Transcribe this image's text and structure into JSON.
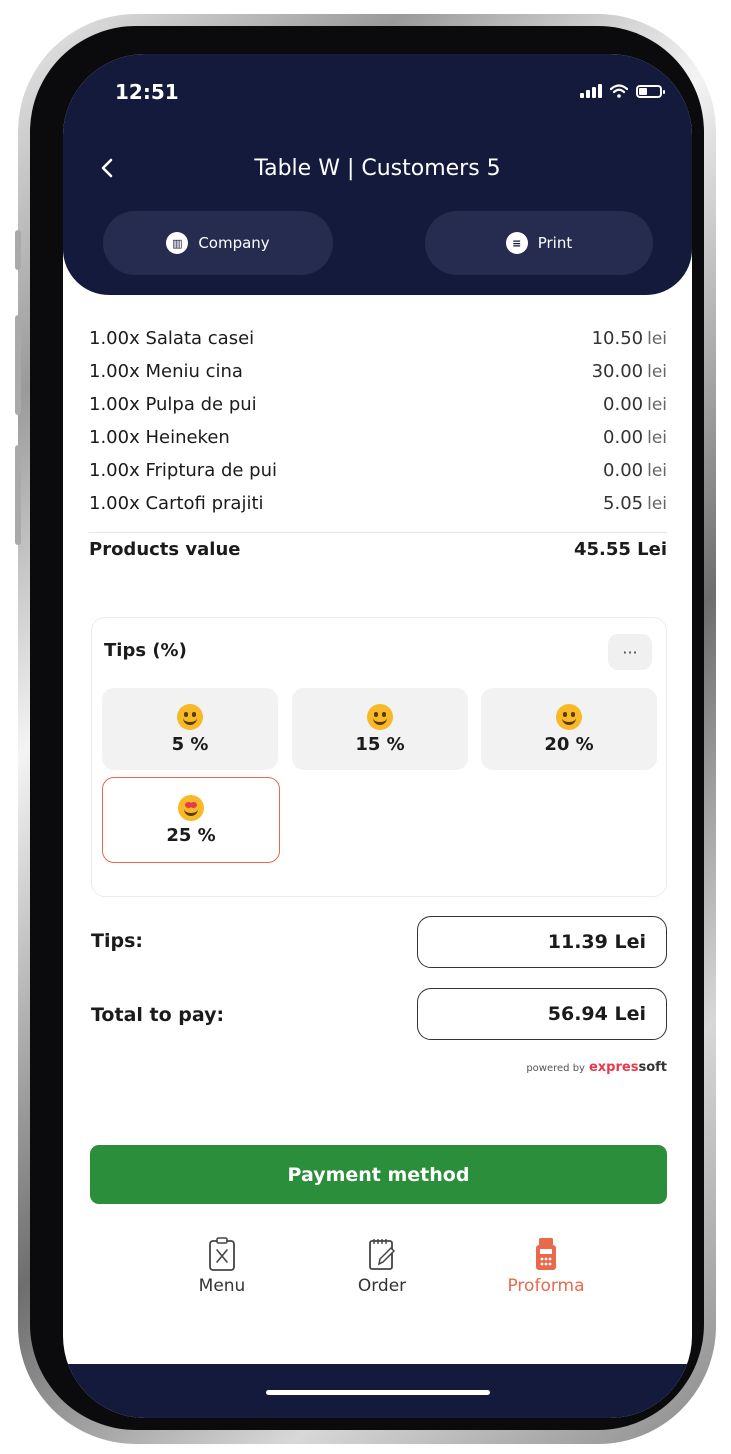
{
  "status_bar": {
    "time": "12:51"
  },
  "header": {
    "title": "Table W | Customers 5",
    "company_label": "Company",
    "print_label": "Print"
  },
  "items": [
    {
      "qty": "1.00x",
      "name": "Salata casei",
      "price": "10.50",
      "unit": "lei"
    },
    {
      "qty": "1.00x",
      "name": "Meniu cina",
      "price": "30.00",
      "unit": "lei"
    },
    {
      "qty": "1.00x",
      "name": "Pulpa de pui",
      "price": "0.00",
      "unit": "lei"
    },
    {
      "qty": "1.00x",
      "name": "Heineken",
      "price": "0.00",
      "unit": "lei"
    },
    {
      "qty": "1.00x",
      "name": "Friptura de pui",
      "price": "0.00",
      "unit": "lei"
    },
    {
      "qty": "1.00x",
      "name": "Cartofi prajiti",
      "price": "5.05",
      "unit": "lei"
    }
  ],
  "products_value": {
    "label": "Products value",
    "amount": "45.55 Lei"
  },
  "tips": {
    "title": "Tips (%)",
    "more_label": "···",
    "options": [
      {
        "label": "5 %",
        "emoji": "smiling-face-icon",
        "selected": false
      },
      {
        "label": "15 %",
        "emoji": "grinning-face-icon",
        "selected": false
      },
      {
        "label": "20 %",
        "emoji": "grinning-face-icon",
        "selected": false
      },
      {
        "label": "25 %",
        "emoji": "heart-eyes-face-icon",
        "selected": true
      }
    ]
  },
  "summary": {
    "tips_label": "Tips:",
    "tips_amount": "11.39 Lei",
    "total_label": "Total to pay:",
    "total_amount": "56.94 Lei"
  },
  "powered_by": {
    "prefix": "powered by",
    "brand_a": "expres",
    "brand_b": "soft"
  },
  "payment_button": "Payment method",
  "nav": {
    "menu": "Menu",
    "order": "Order",
    "proforma": "Proforma",
    "active": "proforma"
  },
  "colors": {
    "header_bg": "#141a3c",
    "accent": "#e8694b",
    "pay_green": "#2b8e3a"
  }
}
